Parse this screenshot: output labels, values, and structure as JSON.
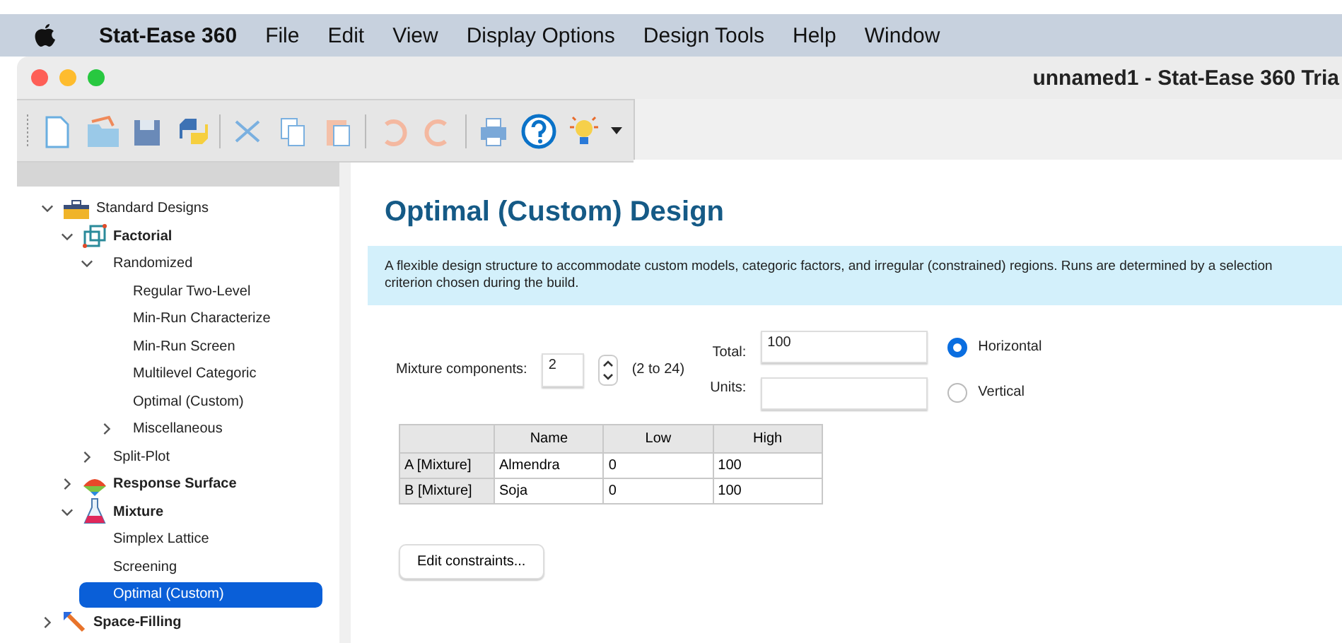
{
  "menu_bar": {
    "app_name": "Stat-Ease 360",
    "items": [
      "File",
      "Edit",
      "View",
      "Display Options",
      "Design Tools",
      "Help",
      "Window"
    ]
  },
  "window": {
    "title": "unnamed1 - Stat-Ease 360 Tria"
  },
  "tree": [
    {
      "label": "Standard Designs",
      "kind": "category",
      "expanded": true,
      "selected": false,
      "children": [
        {
          "label": "Factorial",
          "kind": "group",
          "expanded": true,
          "selected": false,
          "children": [
            {
              "label": "Randomized",
              "kind": "item",
              "expanded": true,
              "selected": false,
              "children": [
                {
                  "label": "Regular Two-Level",
                  "kind": "item",
                  "selected": false
                },
                {
                  "label": "Min-Run Characterize",
                  "kind": "item",
                  "selected": false
                },
                {
                  "label": "Min-Run Screen",
                  "kind": "item",
                  "selected": false
                },
                {
                  "label": "Multilevel Categoric",
                  "kind": "item",
                  "selected": false
                },
                {
                  "label": "Optimal (Custom)",
                  "kind": "item",
                  "selected": false
                },
                {
                  "label": "Miscellaneous",
                  "kind": "item",
                  "expanded": false,
                  "selected": false
                }
              ]
            },
            {
              "label": "Split-Plot",
              "kind": "item",
              "expanded": false,
              "selected": false
            }
          ]
        },
        {
          "label": "Response Surface",
          "kind": "group",
          "expanded": false,
          "selected": false
        },
        {
          "label": "Mixture",
          "kind": "group",
          "expanded": true,
          "selected": false,
          "children": [
            {
              "label": "Simplex Lattice",
              "kind": "item",
              "selected": false
            },
            {
              "label": "Screening",
              "kind": "item",
              "selected": false
            },
            {
              "label": "Optimal (Custom)",
              "kind": "item",
              "selected": true
            }
          ]
        }
      ]
    },
    {
      "label": "Space-Filling",
      "kind": "group",
      "expanded": false,
      "selected": false
    }
  ],
  "main": {
    "title": "Optimal (Custom) Design",
    "description": "A flexible design structure to accommodate custom models, categoric factors, and irregular (constrained) regions. Runs are determined by a selection criterion chosen during the build.",
    "mixture_components": {
      "label": "Mixture components:",
      "value": "2",
      "range": "(2 to 24)"
    },
    "total": {
      "label": "Total:",
      "value": "100"
    },
    "units": {
      "label": "Units:"
    },
    "orientation": [
      {
        "label": "Horizontal",
        "selected": true
      },
      {
        "label": "Vertical",
        "selected": false
      }
    ],
    "table": {
      "columns": [
        "Name",
        "Low",
        "High"
      ],
      "rows": [
        {
          "header": "A [Mixture]",
          "cells": [
            "Almendra",
            "0",
            "100"
          ]
        },
        {
          "header": "B [Mixture]",
          "cells": [
            "Soja",
            "0",
            "100"
          ]
        }
      ]
    },
    "button": "Edit constraints..."
  }
}
